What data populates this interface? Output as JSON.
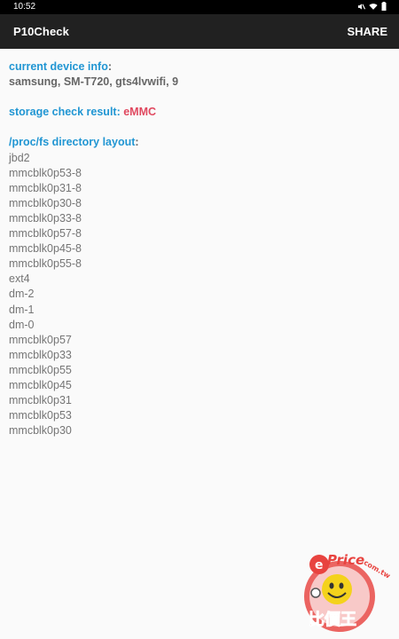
{
  "status_bar": {
    "time": "10:52",
    "icons": [
      "mute-icon",
      "wifi-icon",
      "battery-icon"
    ]
  },
  "app_bar": {
    "title": "P10Check",
    "share_label": "SHARE"
  },
  "device_info": {
    "label": "current device info",
    "colon": ":",
    "value": "samsung, SM-T720, gts4lvwifi, 9"
  },
  "storage_check": {
    "label": "storage check result: ",
    "value": "eMMC"
  },
  "proc_fs": {
    "label": "/proc/fs directory layout",
    "colon": ":",
    "entries": [
      "jbd2",
      "mmcblk0p53-8",
      "mmcblk0p31-8",
      "mmcblk0p30-8",
      "mmcblk0p33-8",
      "mmcblk0p57-8",
      "mmcblk0p45-8",
      "mmcblk0p55-8",
      "ext4",
      "dm-2",
      "dm-1",
      "dm-0",
      "mmcblk0p57",
      "mmcblk0p33",
      "mmcblk0p55",
      "mmcblk0p45",
      "mmcblk0p31",
      "mmcblk0p53",
      "mmcblk0p30"
    ]
  },
  "watermark": {
    "brand": "ePrice",
    "domain": ".com.tw",
    "chinese": "比價王"
  },
  "colors": {
    "app_bar": "#212121",
    "section_label": "#2196d3",
    "emmc": "#e0485f",
    "entry_text": "#757575",
    "background": "#fafafa"
  }
}
